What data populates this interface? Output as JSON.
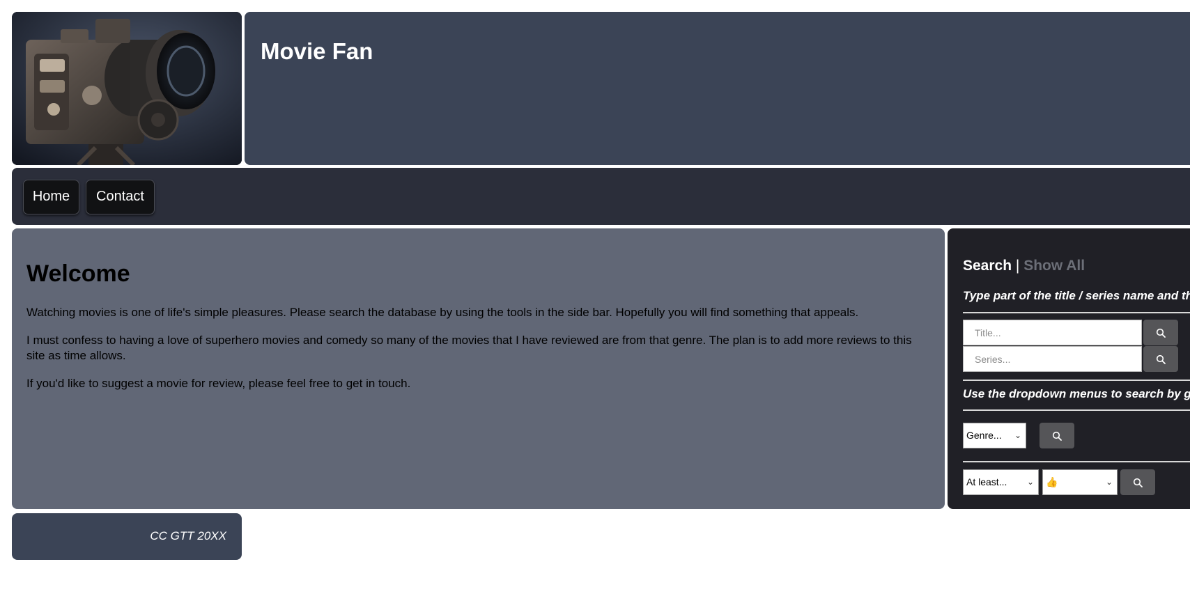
{
  "header": {
    "site_title": "Movie Fan",
    "logo_alt": "film camera"
  },
  "nav": {
    "home_label": "Home",
    "contact_label": "Contact"
  },
  "main": {
    "heading": "Welcome",
    "paragraphs": [
      "Watching movies is one of life's simple pleasures. Please search the database by using the tools in the side bar. Hopefully you will find something that appeals.",
      "I must confess to having a love of superhero movies and comedy so many of the movies that I have reviewed are from that genre. The plan is to add more reviews to this site as time allows.",
      "If you'd like to suggest a movie for review, please feel free to get in touch."
    ]
  },
  "sidebar": {
    "tab_search": "Search",
    "tab_separator": "|",
    "tab_show_all": "Show All",
    "hint_text_search": "Type part of the title / series name and th",
    "title_placeholder": "Title...",
    "series_placeholder": "Series...",
    "hint_dropdown": "Use the dropdown menus to search by ge",
    "genre_select": "Genre...",
    "min_rating_select": "At least...",
    "rating_select": "👍"
  },
  "footer": {
    "text": "CC GTT 20XX"
  },
  "colors": {
    "banner": "#3b4456",
    "nav": "#2b2e3a",
    "main_panel": "#616776",
    "sidebar": "#202026",
    "inactive_tab": "#6c6f78"
  }
}
